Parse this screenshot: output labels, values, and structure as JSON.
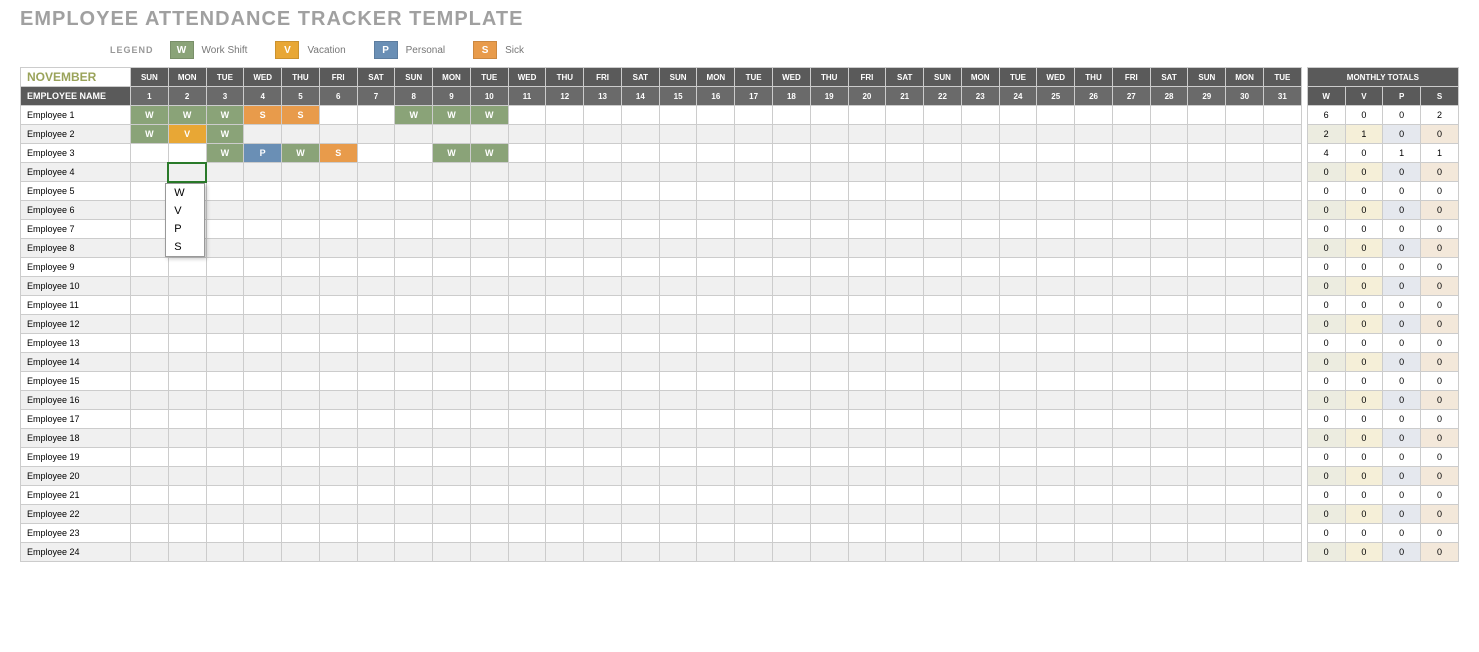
{
  "title": "EMPLOYEE ATTENDANCE TRACKER TEMPLATE",
  "legend": {
    "label": "LEGEND",
    "items": [
      {
        "code": "W",
        "text": "Work Shift",
        "cls": "leg-w"
      },
      {
        "code": "V",
        "text": "Vacation",
        "cls": "leg-v"
      },
      {
        "code": "P",
        "text": "Personal",
        "cls": "leg-p"
      },
      {
        "code": "S",
        "text": "Sick",
        "cls": "leg-s"
      }
    ]
  },
  "month": "NOVEMBER",
  "days_header": [
    "SUN",
    "MON",
    "TUE",
    "WED",
    "THU",
    "FRI",
    "SAT",
    "SUN",
    "MON",
    "TUE",
    "WED",
    "THU",
    "FRI",
    "SAT",
    "SUN",
    "MON",
    "TUE",
    "WED",
    "THU",
    "FRI",
    "SAT",
    "SUN",
    "MON",
    "TUE",
    "WED",
    "THU",
    "FRI",
    "SAT",
    "SUN",
    "MON",
    "TUE"
  ],
  "dates": [
    "1",
    "2",
    "3",
    "4",
    "5",
    "6",
    "7",
    "8",
    "9",
    "10",
    "11",
    "12",
    "13",
    "14",
    "15",
    "16",
    "17",
    "18",
    "19",
    "20",
    "21",
    "22",
    "23",
    "24",
    "25",
    "26",
    "27",
    "28",
    "29",
    "30",
    "31"
  ],
  "name_header": "EMPLOYEE NAME",
  "totals_header": "MONTHLY TOTALS",
  "totals_cols": [
    "W",
    "V",
    "P",
    "S"
  ],
  "dropdown": [
    "W",
    "V",
    "P",
    "S"
  ],
  "selected": {
    "row": 3,
    "col": 1
  },
  "employees": [
    {
      "name": "Employee 1",
      "cells": {
        "0": "W",
        "1": "W",
        "2": "W",
        "3": "S",
        "4": "S",
        "7": "W",
        "8": "W",
        "9": "W"
      },
      "totals": [
        6,
        0,
        0,
        2
      ]
    },
    {
      "name": "Employee 2",
      "cells": {
        "0": "W",
        "1": "V",
        "2": "W"
      },
      "totals": [
        2,
        1,
        0,
        0
      ]
    },
    {
      "name": "Employee 3",
      "cells": {
        "2": "W",
        "3": "P",
        "4": "W",
        "5": "S",
        "8": "W",
        "9": "W"
      },
      "totals": [
        4,
        0,
        1,
        1
      ]
    },
    {
      "name": "Employee 4",
      "cells": {},
      "totals": [
        0,
        0,
        0,
        0
      ]
    },
    {
      "name": "Employee 5",
      "cells": {},
      "totals": [
        0,
        0,
        0,
        0
      ]
    },
    {
      "name": "Employee 6",
      "cells": {},
      "totals": [
        0,
        0,
        0,
        0
      ]
    },
    {
      "name": "Employee 7",
      "cells": {},
      "totals": [
        0,
        0,
        0,
        0
      ]
    },
    {
      "name": "Employee 8",
      "cells": {},
      "totals": [
        0,
        0,
        0,
        0
      ]
    },
    {
      "name": "Employee 9",
      "cells": {},
      "totals": [
        0,
        0,
        0,
        0
      ]
    },
    {
      "name": "Employee 10",
      "cells": {},
      "totals": [
        0,
        0,
        0,
        0
      ]
    },
    {
      "name": "Employee 11",
      "cells": {},
      "totals": [
        0,
        0,
        0,
        0
      ]
    },
    {
      "name": "Employee 12",
      "cells": {},
      "totals": [
        0,
        0,
        0,
        0
      ]
    },
    {
      "name": "Employee 13",
      "cells": {},
      "totals": [
        0,
        0,
        0,
        0
      ]
    },
    {
      "name": "Employee 14",
      "cells": {},
      "totals": [
        0,
        0,
        0,
        0
      ]
    },
    {
      "name": "Employee 15",
      "cells": {},
      "totals": [
        0,
        0,
        0,
        0
      ]
    },
    {
      "name": "Employee 16",
      "cells": {},
      "totals": [
        0,
        0,
        0,
        0
      ]
    },
    {
      "name": "Employee 17",
      "cells": {},
      "totals": [
        0,
        0,
        0,
        0
      ]
    },
    {
      "name": "Employee 18",
      "cells": {},
      "totals": [
        0,
        0,
        0,
        0
      ]
    },
    {
      "name": "Employee 19",
      "cells": {},
      "totals": [
        0,
        0,
        0,
        0
      ]
    },
    {
      "name": "Employee 20",
      "cells": {},
      "totals": [
        0,
        0,
        0,
        0
      ]
    },
    {
      "name": "Employee 21",
      "cells": {},
      "totals": [
        0,
        0,
        0,
        0
      ]
    },
    {
      "name": "Employee 22",
      "cells": {},
      "totals": [
        0,
        0,
        0,
        0
      ]
    },
    {
      "name": "Employee 23",
      "cells": {},
      "totals": [
        0,
        0,
        0,
        0
      ]
    },
    {
      "name": "Employee 24",
      "cells": {},
      "totals": [
        0,
        0,
        0,
        0
      ]
    }
  ]
}
